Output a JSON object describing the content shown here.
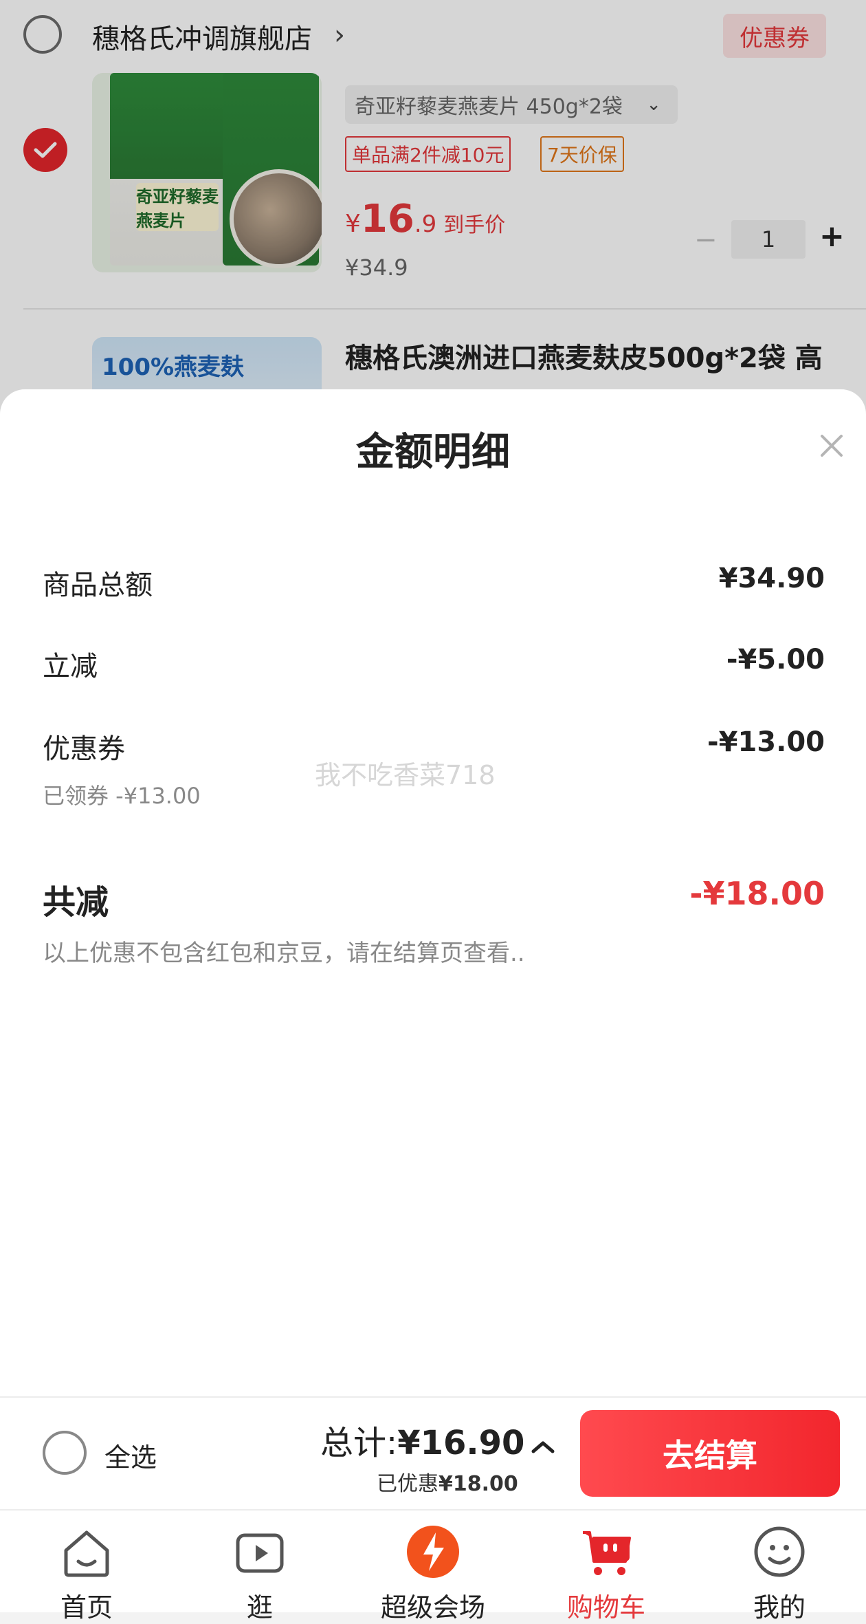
{
  "colors": {
    "accent": "#e4393c",
    "tag_orange": "#e0761a",
    "checkout_gradient": [
      "#ff4a4f",
      "#f2262d"
    ]
  },
  "store": {
    "name": "穗格氏冲调旗舰店",
    "chevron": "›",
    "coupon_label": "优惠券"
  },
  "product1": {
    "image_label": "奇亚籽藜麦燕麦片",
    "spec": "奇亚籽藜麦燕麦片 450g*2袋",
    "tag_promo": "单品满2件减10元",
    "tag_guarantee": "7天价保",
    "price_currency": "¥",
    "price_int": "16",
    "price_dec": ".9",
    "price_label": "到手价",
    "original_price": "¥34.9",
    "quantity": "1",
    "minus": "−",
    "plus": "+"
  },
  "product2": {
    "image_text": "100%燕麦麸",
    "title": "穗格氏澳洲进口燕麦麸皮500g*2袋 高"
  },
  "sheet": {
    "title": "金额明细",
    "rows": [
      {
        "label": "商品总额",
        "value": "¥34.90"
      },
      {
        "label": "立减",
        "value": "-¥5.00"
      },
      {
        "label": "优惠券",
        "value": "-¥13.00"
      }
    ],
    "coupon_note": "已领券 -¥13.00",
    "watermark": "我不吃香菜718",
    "total_label": "共减",
    "total_value": "-¥18.00",
    "disclaimer": "以上优惠不包含红包和京豆，请在结算页查看.."
  },
  "checkout": {
    "select_all": "全选",
    "sum_prefix": "总计:",
    "sum_amount": "¥16.90",
    "saved_prefix": "已优惠",
    "saved_amount": "¥18.00",
    "button": "去结算"
  },
  "tabs": [
    {
      "label": "首页",
      "icon": "home-icon"
    },
    {
      "label": "逛",
      "icon": "video-icon"
    },
    {
      "label": "超级会场",
      "icon": "promo-venue-icon"
    },
    {
      "label": "购物车",
      "icon": "cart-icon",
      "active": true
    },
    {
      "label": "我的",
      "icon": "profile-icon"
    }
  ]
}
